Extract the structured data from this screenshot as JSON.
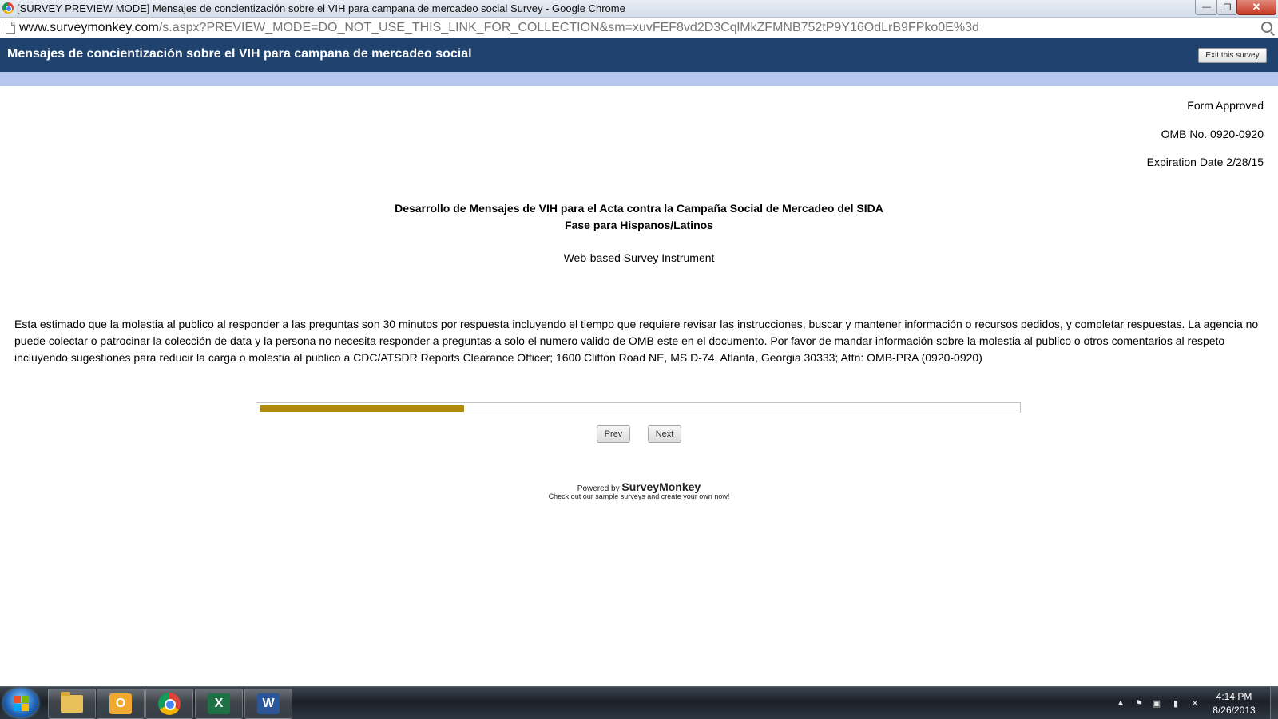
{
  "window": {
    "title": "[SURVEY PREVIEW MODE] Mensajes de concientización sobre el VIH para campana de mercadeo social Survey - Google Chrome",
    "minimize_label": "—",
    "maximize_label": "❐",
    "close_label": "✕"
  },
  "addressbar": {
    "url_host": "www.surveymonkey.com",
    "url_path": "/s.aspx?PREVIEW_MODE=DO_NOT_USE_THIS_LINK_FOR_COLLECTION&sm=xuvFEF8vd2D3CqlMkZFMNB752tP9Y16OdLrB9FPko0E%3d"
  },
  "survey_header": {
    "title": "Mensajes de concientización sobre el VIH para campana de mercadeo social",
    "exit_label": "Exit this survey"
  },
  "approval": {
    "line1": "Form Approved",
    "line2": "OMB No. 0920-0920",
    "line3": "Expiration Date 2/28/15"
  },
  "heading": {
    "line1": "Desarrollo de Mensajes de VIH para el Acta contra la Campaña Social de Mercadeo del SIDA",
    "line2": "Fase para Hispanos/Latinos",
    "subtitle": "Web-based Survey Instrument"
  },
  "burden_statement": "Esta estimado que la molestia al publico al responder a las preguntas son 30 minutos por respuesta incluyendo el tiempo que requiere revisar las instrucciones, buscar y mantener información o recursos pedidos, y completar respuestas. La agencia no puede colectar o patrocinar la colección de data y la persona no necesita responder a preguntas a solo el numero valido de OMB este en el documento. Por favor de mandar información sobre la molestia al publico o otros comentarios al respeto incluyendo sugestiones para reducir la carga o molestia al publico a CDC/ATSDR Reports Clearance Officer; 1600 Clifton Road NE, MS D-74, Atlanta, Georgia 30333; Attn: OMB-PRA (0920-0920)",
  "progress": {
    "fraction": 0.27,
    "color": "#b08c0e"
  },
  "nav": {
    "prev_label": "Prev",
    "next_label": "Next"
  },
  "footer": {
    "powered_by": "Powered by",
    "brand": "SurveyMonkey",
    "checkout_before": "Check out our",
    "checkout_link": "sample surveys",
    "checkout_after": "and create your own now!"
  },
  "taskbar": {
    "apps": [
      {
        "icon": "file-explorer-icon"
      },
      {
        "icon": "outlook-icon",
        "glyph": "O"
      },
      {
        "icon": "chrome-icon"
      },
      {
        "icon": "excel-icon",
        "glyph": "X"
      },
      {
        "icon": "word-icon",
        "glyph": "W"
      }
    ],
    "tray": [
      "▲",
      "⚑",
      "▣",
      "▮",
      "✕"
    ],
    "clock_time": "4:14 PM",
    "clock_date": "8/26/2013"
  },
  "colors": {
    "header_bg": "#1f426e",
    "header_band": "#b6c8f0",
    "progress_fill": "#b08c0e"
  }
}
